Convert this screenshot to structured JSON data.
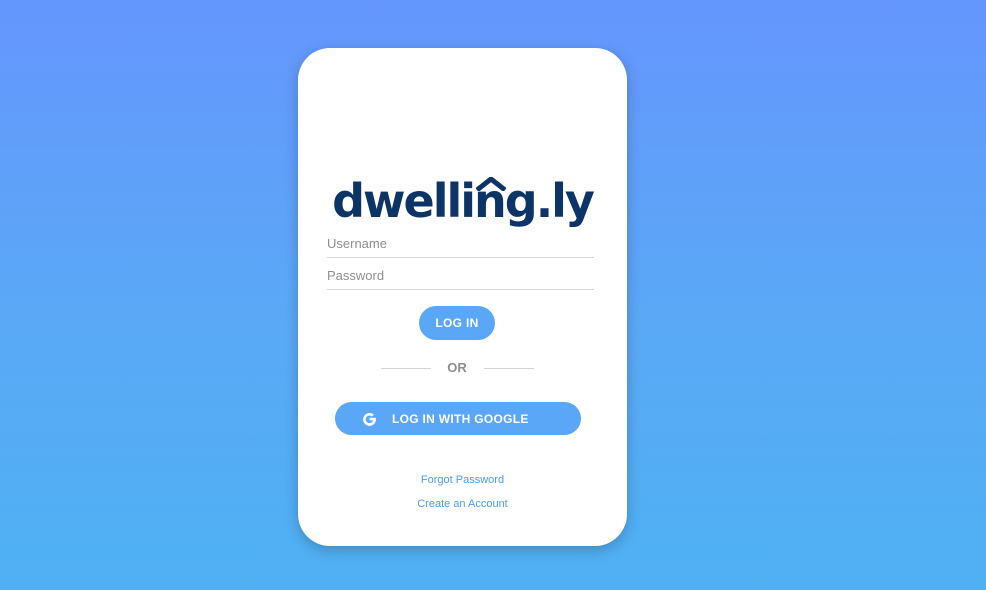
{
  "logo": {
    "part1": "dwelli",
    "part2": "n",
    "part3": "g.ly"
  },
  "form": {
    "username_placeholder": "Username",
    "password_placeholder": "Password",
    "login_label": "LOG IN"
  },
  "divider": {
    "text": "OR"
  },
  "google": {
    "label": "LOG IN WITH GOOGLE",
    "icon": "google-g-icon"
  },
  "links": {
    "forgot": "Forgot Password",
    "create": "Create an Account"
  },
  "colors": {
    "brand_navy": "#0d3466",
    "button_blue": "#5aa6f7",
    "link_blue": "#4b9bf3",
    "background_top": "#6596fd",
    "background_bottom": "#4fb1f3"
  }
}
